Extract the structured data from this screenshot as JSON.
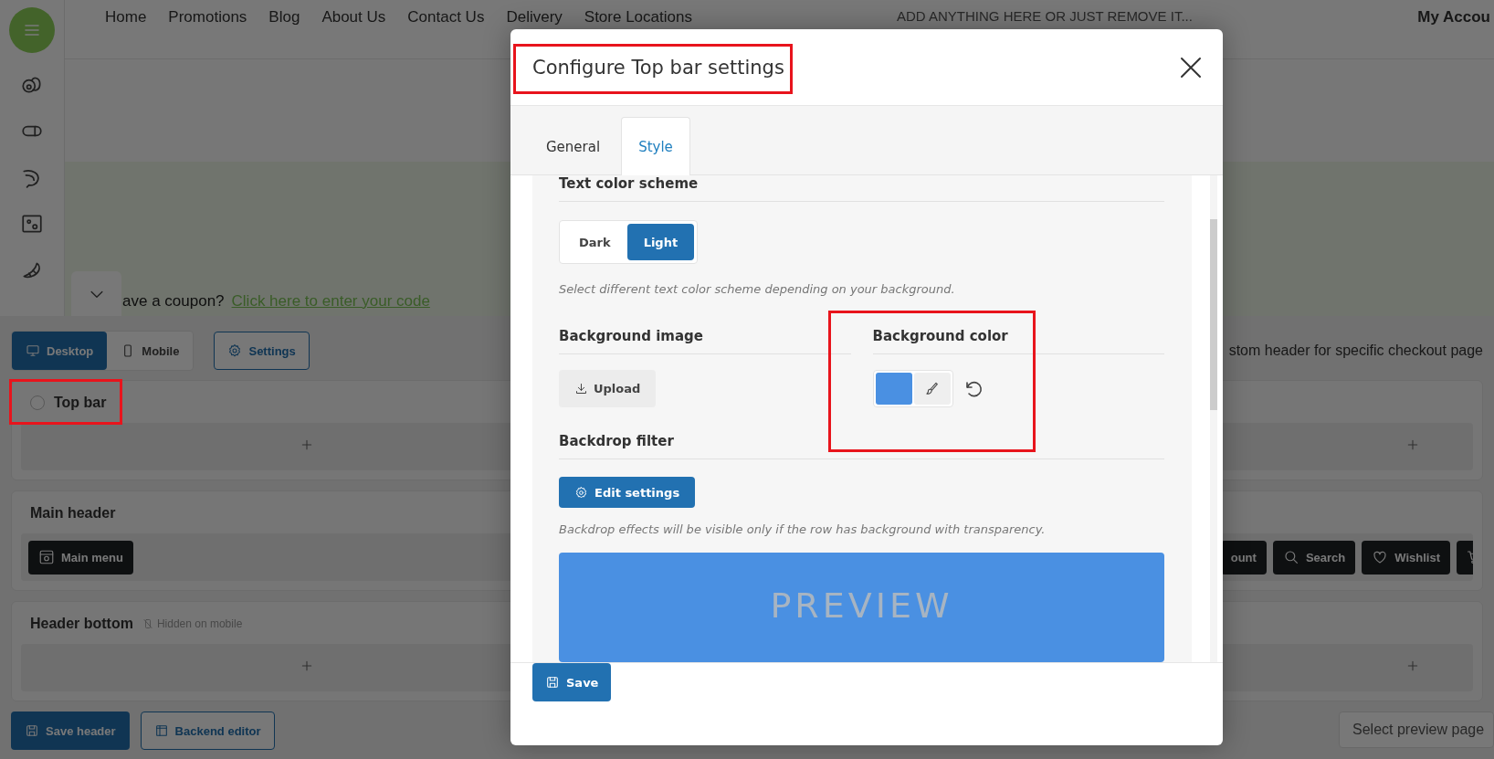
{
  "nav": {
    "items": [
      "Home",
      "Promotions",
      "Blog",
      "About Us",
      "Contact Us",
      "Delivery",
      "Store Locations"
    ],
    "promo": "ADD ANYTHING HERE OR JUST REMOVE IT...",
    "account": "My Accou"
  },
  "coupon": {
    "text": "ave a coupon?",
    "link": "Click here to enter your code"
  },
  "builder": {
    "devices": [
      {
        "label": "Desktop",
        "kind": "desktop",
        "selected": true
      },
      {
        "label": "Mobile",
        "kind": "mobile",
        "selected": false
      }
    ],
    "settings_button": "Settings",
    "note": "stom header for specific checkout page",
    "rows": [
      {
        "title": "Top bar",
        "kind": "toggle",
        "checked": false,
        "left": [],
        "right": []
      },
      {
        "title": "Main header",
        "kind": "plain",
        "left": [
          {
            "label": "Main menu",
            "kind": "menu"
          }
        ],
        "right": [
          {
            "label": "ount",
            "kind": "account"
          },
          {
            "label": "Search",
            "kind": "search"
          },
          {
            "label": "Wishlist",
            "kind": "wishlist"
          },
          {
            "kind": "cart"
          }
        ]
      },
      {
        "title": "Header bottom",
        "kind": "plain",
        "hint": "Hidden on mobile",
        "left": [],
        "right": []
      }
    ],
    "save_button": "Save header",
    "backend_button": "Backend editor",
    "preview_select": "Select preview page"
  },
  "modal": {
    "title": "Configure Top bar settings",
    "tabs": [
      {
        "label": "General",
        "selected": false
      },
      {
        "label": "Style",
        "selected": true
      }
    ],
    "text_scheme": {
      "heading": "Text color scheme",
      "options": [
        {
          "label": "Dark",
          "selected": false
        },
        {
          "label": "Light",
          "selected": true
        }
      ],
      "hint": "Select different text color scheme depending on your background."
    },
    "background_image": {
      "heading": "Background image",
      "button": "Upload"
    },
    "background_color": {
      "heading": "Background color",
      "color": "#4a90e2"
    },
    "backdrop": {
      "heading": "Backdrop filter",
      "button": "Edit settings",
      "hint": "Backdrop effects will be visible only if the row has background with transparency."
    },
    "preview": {
      "text": "PREVIEW"
    },
    "save": "Save"
  }
}
